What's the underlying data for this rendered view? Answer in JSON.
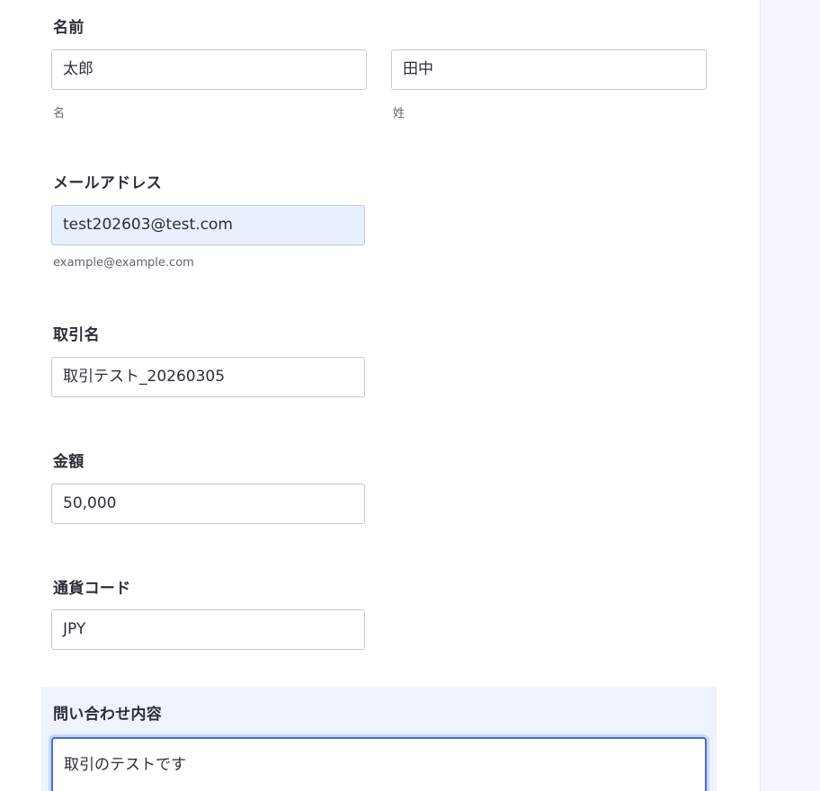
{
  "name": {
    "label": "名前",
    "first_value": "太郎",
    "first_sublabel": "名",
    "last_value": "田中",
    "last_sublabel": "姓"
  },
  "email": {
    "label": "メールアドレス",
    "value": "test202603@test.com",
    "hint": "example@example.com"
  },
  "deal_name": {
    "label": "取引名",
    "value": "取引テスト_20260305"
  },
  "amount": {
    "label": "金額",
    "value": "50,000"
  },
  "currency": {
    "label": "通貨コード",
    "value": "JPY"
  },
  "inquiry": {
    "label": "問い合わせ内容",
    "value": "取引のテストです"
  }
}
